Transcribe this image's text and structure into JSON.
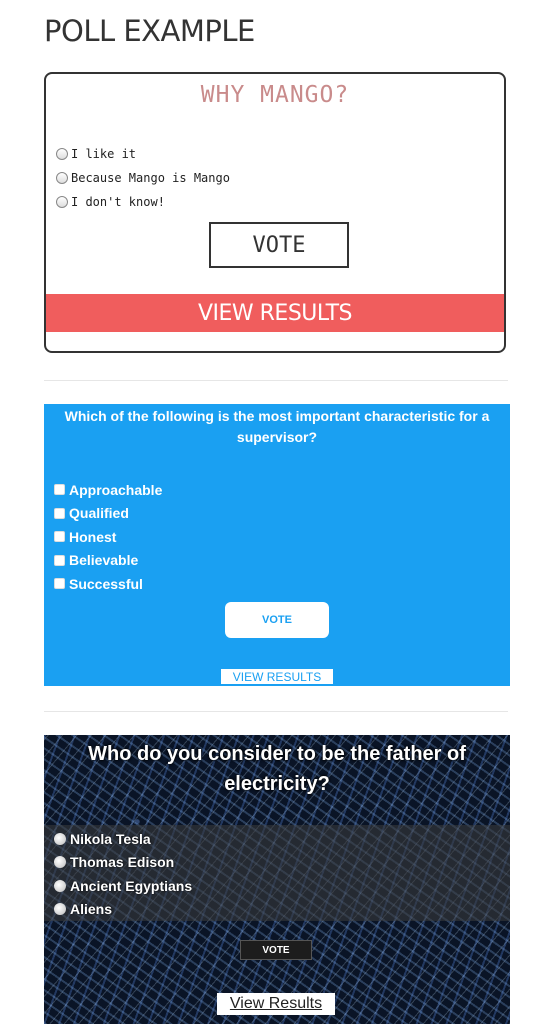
{
  "page": {
    "title": "POLL EXAMPLE"
  },
  "poll1": {
    "question": "WHY MANGO?",
    "options": [
      "I like it",
      "Because Mango is Mango",
      "I don't know!"
    ],
    "vote_label": "VOTE",
    "results_label": "VIEW RESULTS",
    "colors": {
      "question": "#c98b8b",
      "results_bg": "#f05d5d",
      "border": "#333333"
    }
  },
  "poll2": {
    "question": "Which of the following is the most important characteristic for a supervisor?",
    "options": [
      "Approachable",
      "Qualified",
      "Honest",
      "Believable",
      "Successful"
    ],
    "vote_label": "VOTE",
    "results_label": "VIEW RESULTS",
    "colors": {
      "background": "#1aa0f2",
      "text": "#ffffff"
    }
  },
  "poll3": {
    "question": "Who do you consider to be the father of electricity?",
    "options": [
      "Nikola Tesla",
      "Thomas Edison",
      "Ancient Egyptians",
      "Aliens"
    ],
    "vote_label": "VOTE",
    "results_label": "View Results",
    "colors": {
      "background": "#0a1426",
      "vote_bg": "#1d1d1d"
    }
  }
}
